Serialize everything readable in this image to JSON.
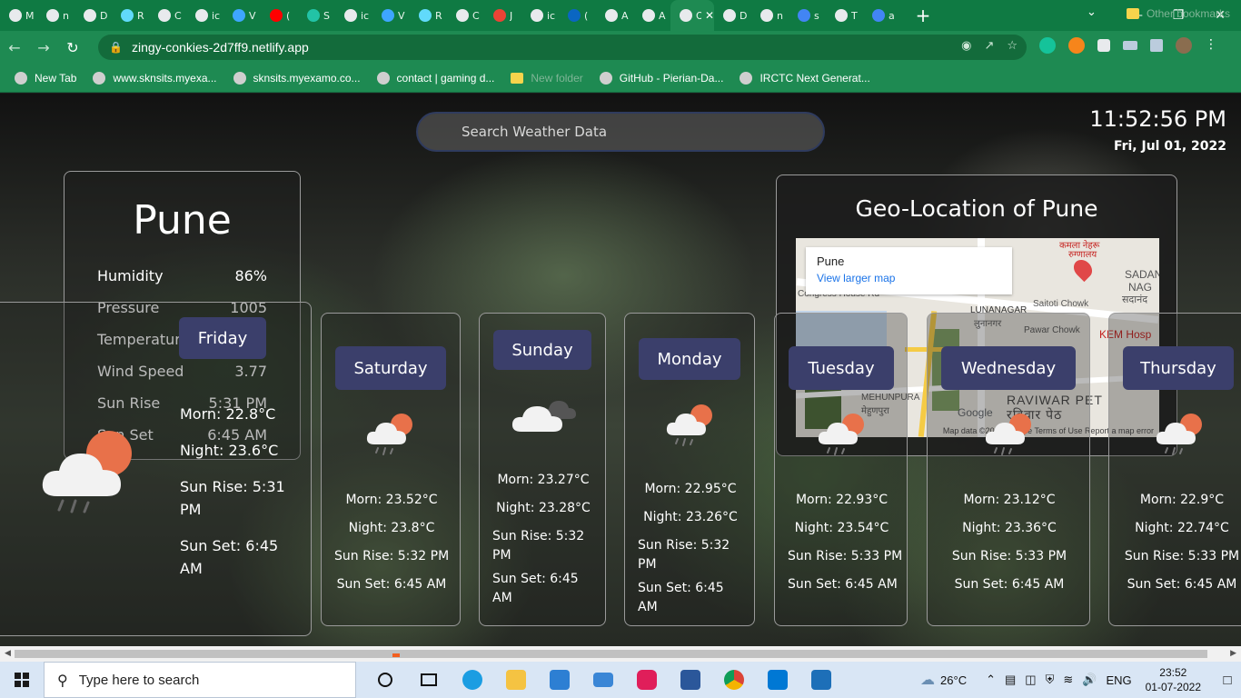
{
  "browser": {
    "tabs": [
      {
        "label": "M",
        "color": "#e8eaed"
      },
      {
        "label": "n",
        "color": "#e8eaed"
      },
      {
        "label": "D",
        "color": "#e8eaed"
      },
      {
        "label": "R",
        "color": "#61dafb"
      },
      {
        "label": "C",
        "color": "#e8eaed"
      },
      {
        "label": "ic",
        "color": "#e8eaed"
      },
      {
        "label": "V",
        "color": "#3ea6ff"
      },
      {
        "label": "(",
        "color": "#ff0000"
      },
      {
        "label": "S",
        "color": "#22c3a6"
      },
      {
        "label": "ic",
        "color": "#e8eaed"
      },
      {
        "label": "V",
        "color": "#3ea6ff"
      },
      {
        "label": "R",
        "color": "#61dafb"
      },
      {
        "label": "C",
        "color": "#e8eaed"
      },
      {
        "label": "J",
        "color": "#ea4335"
      },
      {
        "label": "ic",
        "color": "#e8eaed"
      },
      {
        "label": "(",
        "color": "#0a66c2"
      },
      {
        "label": "A",
        "color": "#e8eaed"
      },
      {
        "label": "A",
        "color": "#e8eaed"
      },
      {
        "label": "O",
        "color": "#e8eaed",
        "active": true
      },
      {
        "label": "D",
        "color": "#e8eaed"
      },
      {
        "label": "n",
        "color": "#e8eaed"
      },
      {
        "label": "s",
        "color": "#4285f4"
      },
      {
        "label": "T",
        "color": "#e8eaed"
      },
      {
        "label": "a",
        "color": "#4285f4"
      }
    ],
    "url": "zingy-conkies-2d7ff9.netlify.app",
    "bookmarks": [
      {
        "label": "New Tab",
        "kind": "icon"
      },
      {
        "label": "www.sknsits.myexa...",
        "kind": "icon"
      },
      {
        "label": "sknsits.myexamo.co...",
        "kind": "icon"
      },
      {
        "label": "contact | gaming d...",
        "kind": "icon"
      },
      {
        "label": "New folder",
        "kind": "folder"
      },
      {
        "label": "GitHub - Pierian-Da...",
        "kind": "icon"
      },
      {
        "label": "IRCTC Next Generat...",
        "kind": "icon"
      }
    ],
    "other_bookmarks": "Other bookmarks"
  },
  "page": {
    "search_placeholder": "Search Weather Data",
    "time": "11:52:56 PM",
    "date": "Fri, Jul 01, 2022",
    "city": {
      "name": "Pune",
      "stats": [
        {
          "label": "Humidity",
          "value": "86%"
        },
        {
          "label": "Pressure",
          "value": "1005"
        },
        {
          "label": "Temperature",
          "value": ""
        },
        {
          "label": "Wind Speed",
          "value": "3.77"
        },
        {
          "label": "Sun Rise",
          "value": "5:31 PM"
        },
        {
          "label": "Sun Set",
          "value": "6:45 AM"
        }
      ]
    },
    "geo": {
      "title": "Geo-Location of Pune",
      "popup_name": "Pune",
      "popup_link": "View larger map",
      "attribution": "Map data ©2022 Google  Terms of Use  Report a map error",
      "google": "Google",
      "labels": [
        "Congress House Rd",
        "LUNANAGAR",
        "लुनानगर",
        "Saitoti Chowk",
        "Pawar Chowk",
        "KEM Hosp",
        "SADAN",
        "NAG",
        "सदानंद",
        "MEHUNPURA",
        "मेहुणपुरा",
        "RAVIWAR PET",
        "रविवार पेठ",
        "कमला नेहरू",
        "रुग्णालय"
      ]
    },
    "today": {
      "day": "Friday",
      "morn": "Morn: 22.8°C",
      "night": "Night: 23.6°C",
      "sunrise": "Sun Rise: 5:31 PM",
      "sunset": "Sun Set: 6:45 AM"
    },
    "forecast": [
      {
        "day": "Saturday",
        "morn": "Morn:  23.52°C",
        "night": "Night:  23.8°C",
        "sunrise": "Sun Rise: 5:32 PM",
        "sunset": "Sun Set: 6:45 AM",
        "icon": "rain-sun-icon"
      },
      {
        "day": "Sunday",
        "morn": "Morn:  23.27°C",
        "night": "Night:  23.28°C",
        "sunrise": "Sun Rise: 5:32 PM",
        "sunset": "Sun Set: 6:45 AM",
        "icon": "cloudy-icon"
      },
      {
        "day": "Monday",
        "morn": "Morn:  22.95°C",
        "night": "Night:  23.26°C",
        "sunrise": "Sun Rise: 5:32 PM",
        "sunset": "Sun Set: 6:45 AM",
        "icon": "rain-sun-icon"
      },
      {
        "day": "Tuesday",
        "morn": "Morn:  22.93°C",
        "night": "Night:  23.54°C",
        "sunrise": "Sun Rise: 5:33 PM",
        "sunset": "Sun Set: 6:45 AM",
        "icon": "rain-sun-icon"
      },
      {
        "day": "Wednesday",
        "morn": "Morn:  23.12°C",
        "night": "Night:  23.36°C",
        "sunrise": "Sun Rise: 5:33 PM",
        "sunset": "Sun Set: 6:45 AM",
        "icon": "rain-sun-icon"
      },
      {
        "day": "Thursday",
        "morn": "Morn:  22.9°C",
        "night": "Night:  22.74°C",
        "sunrise": "Sun Rise: 5:33 PM",
        "sunset": "Sun Set: 6:45 AM",
        "icon": "rain-sun-icon"
      }
    ]
  },
  "taskbar": {
    "search_placeholder": "Type here to search",
    "temperature": "26°C",
    "lang": "ENG",
    "time": "23:52",
    "date": "01-07-2022"
  }
}
